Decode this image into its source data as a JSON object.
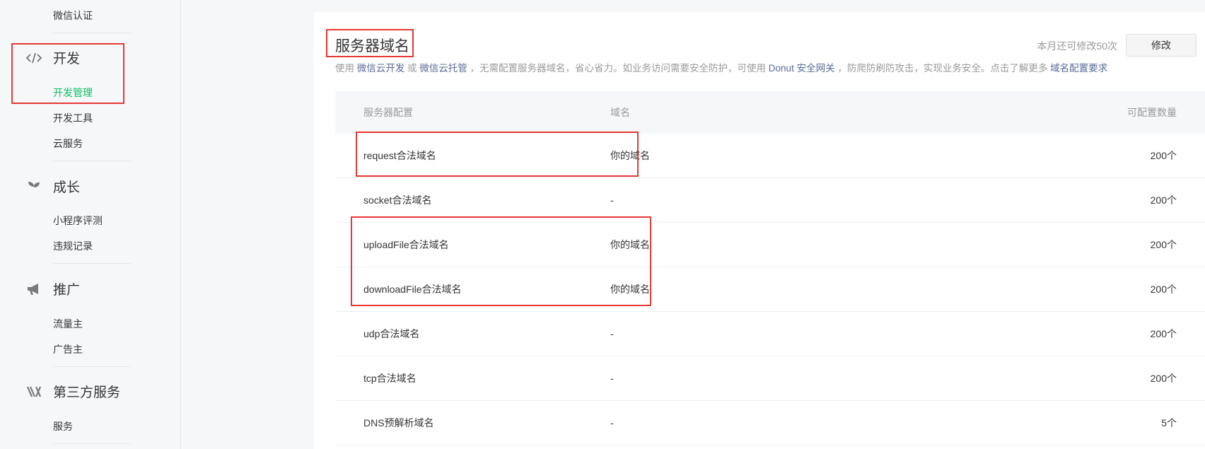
{
  "sidebar": {
    "top_item": "微信认证",
    "groups": [
      {
        "title": "开发",
        "icon": "code-icon",
        "items": [
          "开发管理",
          "开发工具",
          "云服务"
        ]
      },
      {
        "title": "成长",
        "icon": "sprout-icon",
        "items": [
          "小程序评测",
          "违规记录"
        ]
      },
      {
        "title": "推广",
        "icon": "megaphone-icon",
        "items": [
          "流量主",
          "广告主"
        ]
      },
      {
        "title": "第三方服务",
        "icon": "third-party-icon",
        "items": [
          "服务"
        ]
      }
    ],
    "active_item": "开发管理"
  },
  "panel": {
    "title": "服务器域名",
    "quota_text": "本月还可修改50次",
    "edit_button": "修改",
    "desc": {
      "p1": "使用 ",
      "link1": "微信云开发",
      "p2": " 或 ",
      "link2": "微信云托管",
      "p3": " ，无需配置服务器域名，省心省力。如业务访问需要安全防护，可使用 ",
      "link3": "Donut 安全网关",
      "p4": " ，防爬防刷防攻击，实现业务安全。点击了解更多 ",
      "link4": "域名配置要求"
    }
  },
  "table": {
    "headers": [
      "服务器配置",
      "域名",
      "可配置数量"
    ],
    "rows": [
      {
        "config": "request合法域名",
        "domain": "你的域名",
        "count": "200个"
      },
      {
        "config": "socket合法域名",
        "domain": "-",
        "count": "200个"
      },
      {
        "config": "uploadFile合法域名",
        "domain": "你的域名",
        "count": "200个"
      },
      {
        "config": "downloadFile合法域名",
        "domain": "你的域名",
        "count": "200个"
      },
      {
        "config": "udp合法域名",
        "domain": "-",
        "count": "200个"
      },
      {
        "config": "tcp合法域名",
        "domain": "-",
        "count": "200个"
      },
      {
        "config": "DNS预解析域名",
        "domain": "-",
        "count": "5个"
      }
    ]
  },
  "colors": {
    "active": "#07c160",
    "link": "#576b95",
    "highlight": "#e53935"
  }
}
